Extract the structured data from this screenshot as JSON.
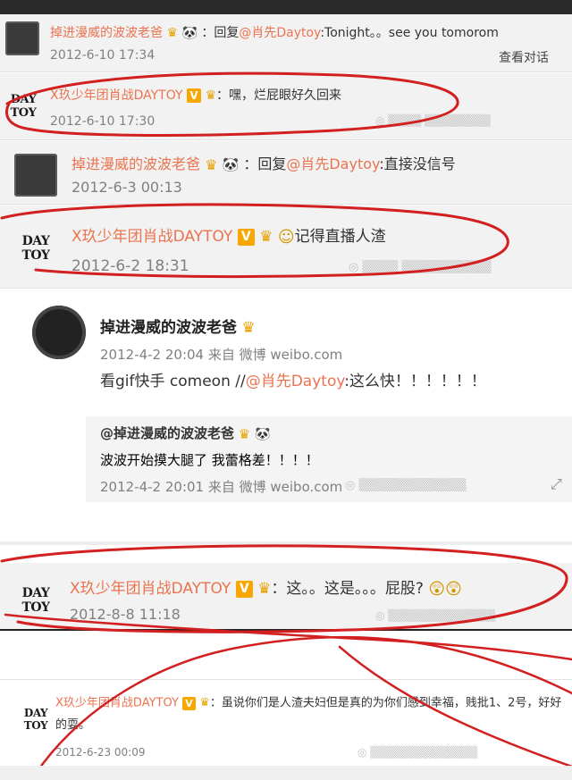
{
  "comments": [
    {
      "author": "掉进漫威的波波老爸",
      "text_prefix": "：回复",
      "mention": "@肖先Daytoy",
      "text": ":Tonight。。see you tomorom",
      "time": "2012-6-10 17:34",
      "action": "查看对话"
    },
    {
      "logo": "DAY TOY",
      "author": "X玖少年团肖战DAYTOY",
      "text": "：嘿，烂屁眼好久回来",
      "time": "2012-6-10 17:30"
    },
    {
      "author": "掉进漫威的波波老爸",
      "text_prefix": "：回复",
      "mention": "@肖先Daytoy",
      "text": ":直接没信号",
      "time": "2012-6-3 00:13"
    },
    {
      "logo": "DAY TOY",
      "author": "X玖少年团肖战DAYTOY",
      "text": "记得直播人渣",
      "time": "2012-6-2 18:31"
    }
  ],
  "post": {
    "author": "掉进漫威的波波老爸",
    "time_source": "2012-4-2 20:04 来自 微博 weibo.com",
    "text": "看gif快手 comeon //",
    "mention": "@肖先Daytoy",
    "text_suffix": ":这么快！！！！！！",
    "quoted_author": "@掉进漫威的波波老爸",
    "quoted_text": "波波开始摸大腿了 我蕾格差！！！！",
    "quoted_time_source": "2012-4-2 20:01 来自 微博 weibo.com"
  },
  "comments2": [
    {
      "logo": "DAY TOY",
      "author": "X玖少年团肖战DAYTOY",
      "text": "：这。。这是。。。屁股?",
      "time": "2012-8-8 11:18"
    },
    {
      "logo": "DAY TOY",
      "author": "X玖少年团肖战DAYTOY",
      "text": "：虽说你们是人渣夫妇但是真的为你们感到幸福，贱批1、2号，好好的耍。",
      "time": "2012-6-23 00:09"
    }
  ],
  "colors": {
    "accent": "#eb7350",
    "annotation": "#d21f1f",
    "vip": "#f7a700"
  },
  "icons": [
    "crown-icon",
    "panda-icon",
    "v-badge-icon",
    "emoji-icon",
    "resize-icon"
  ]
}
